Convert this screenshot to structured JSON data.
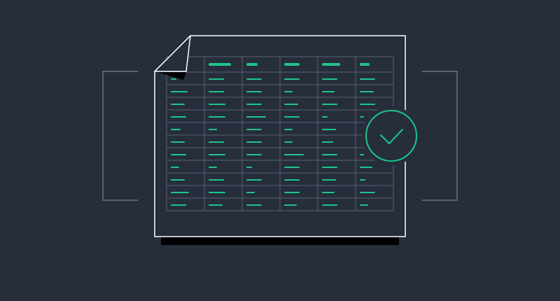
{
  "colors": {
    "background": "#262d3b",
    "outline": "#ffffff",
    "grid": "#5b6373",
    "bracket": "#7a8291",
    "accent": "#1ec68a",
    "shadow": "#000000"
  },
  "icons": {
    "document": "spreadsheet-document-icon",
    "badge": "check-circle-icon",
    "fold": "folded-corner-icon"
  },
  "table": {
    "columns": 6,
    "header_rows": 1,
    "body_rows": 11
  }
}
